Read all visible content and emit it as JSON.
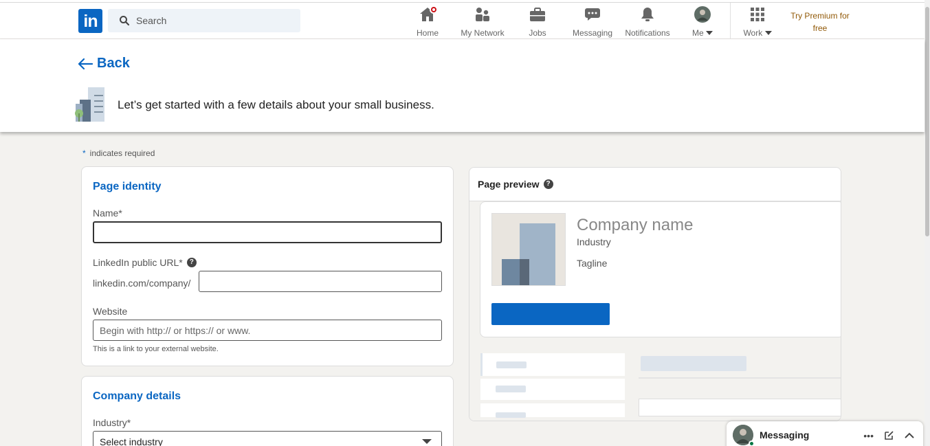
{
  "nav": {
    "search_placeholder": "Search",
    "items": [
      {
        "label": "Home",
        "icon": "home-icon"
      },
      {
        "label": "My Network",
        "icon": "network-icon"
      },
      {
        "label": "Jobs",
        "icon": "briefcase-icon"
      },
      {
        "label": "Messaging",
        "icon": "chat-icon"
      },
      {
        "label": "Notifications",
        "icon": "bell-icon"
      },
      {
        "label": "Me",
        "icon": "avatar"
      },
      {
        "label": "Work",
        "icon": "grid-icon"
      }
    ],
    "premium_line1": "Try Premium for",
    "premium_line2": "free"
  },
  "header": {
    "back_label": "Back",
    "intro_text": "Let’s get started with a few details about your small business."
  },
  "required_note": {
    "star": "*",
    "text": "indicates required"
  },
  "page_identity": {
    "title": "Page identity",
    "name_label": "Name*",
    "name_value": "",
    "url_label": "LinkedIn public URL*",
    "url_prefix": "linkedin.com/company/",
    "url_value": "",
    "website_label": "Website",
    "website_placeholder": "Begin with http:// or https:// or www.",
    "website_helper": "This is a link to your external website."
  },
  "company_details": {
    "title": "Company details",
    "industry_label": "Industry*",
    "industry_selected": "Select industry"
  },
  "preview": {
    "title": "Page preview",
    "company_name": "Company name",
    "industry": "Industry",
    "tagline": "Tagline"
  },
  "messaging": {
    "label": "Messaging"
  },
  "colors": {
    "brand": "#0a66c2",
    "premium": "#915907",
    "badge": "#cc1016"
  }
}
